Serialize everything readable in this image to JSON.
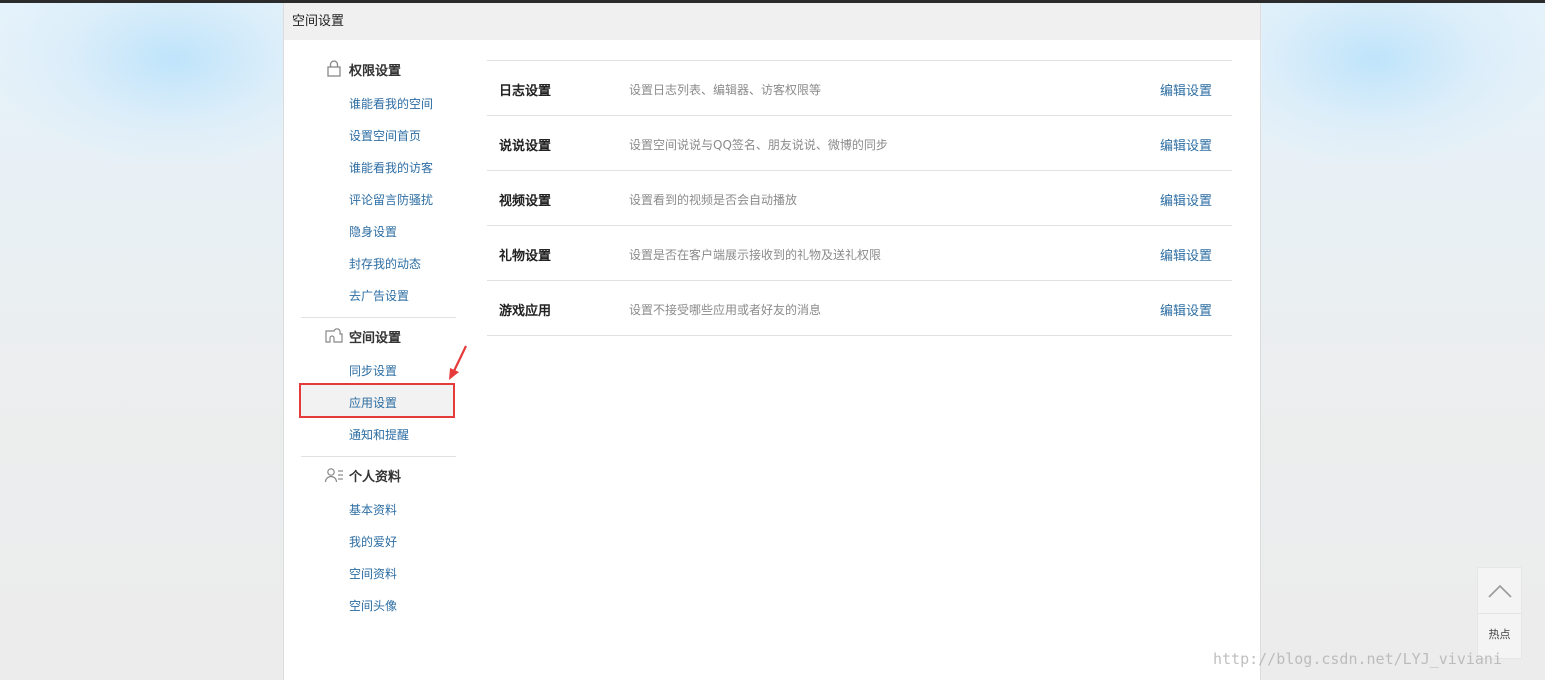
{
  "page": {
    "title": "空间设置"
  },
  "sidebar": {
    "groups": [
      {
        "title": "权限设置",
        "icon": "lock-icon",
        "items": [
          "谁能看我的空间",
          "设置空间首页",
          "谁能看我的访客",
          "评论留言防骚扰",
          "隐身设置",
          "封存我的动态",
          "去广告设置"
        ]
      },
      {
        "title": "空间设置",
        "icon": "puzzle-icon",
        "items": [
          "同步设置",
          "应用设置",
          "通知和提醒"
        ],
        "selected": "应用设置"
      },
      {
        "title": "个人资料",
        "icon": "profile-icon",
        "items": [
          "基本资料",
          "我的爱好",
          "空间资料",
          "空间头像"
        ]
      }
    ]
  },
  "settings": {
    "edit_label": "编辑设置",
    "rows": [
      {
        "title": "日志设置",
        "desc": "设置日志列表、编辑器、访客权限等"
      },
      {
        "title": "说说设置",
        "desc": "设置空间说说与QQ签名、朋友说说、微博的同步"
      },
      {
        "title": "视频设置",
        "desc": "设置看到的视频是否会自动播放"
      },
      {
        "title": "礼物设置",
        "desc": "设置是否在客户端展示接收到的礼物及送礼权限"
      },
      {
        "title": "游戏应用",
        "desc": "设置不接受哪些应用或者好友的消息"
      }
    ]
  },
  "float_tools": {
    "up_icon": "chevron-up-icon",
    "hot_label": "热点"
  },
  "watermark": "http://blog.csdn.net/LYJ_viviani",
  "colors": {
    "link": "#2d6ea3",
    "highlight_border": "#e53b3b",
    "header_bg": "#f0f0f0"
  }
}
